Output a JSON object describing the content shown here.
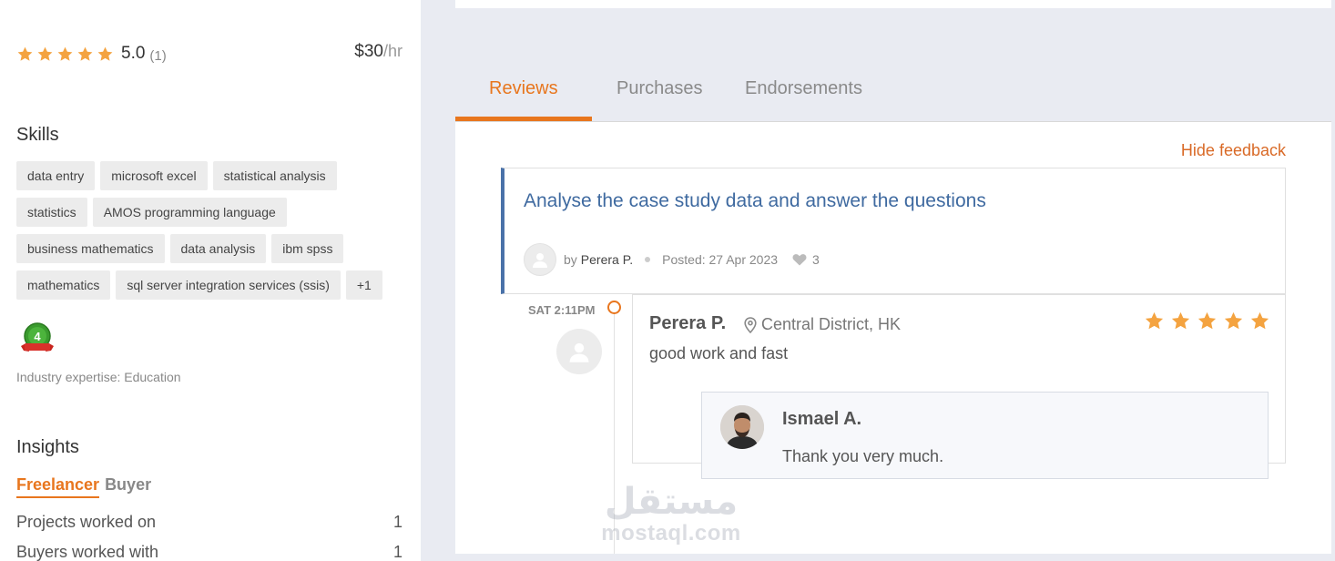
{
  "sidebar": {
    "rating": {
      "value": "5.0",
      "count": "(1)",
      "stars": 5
    },
    "rate": {
      "amount": "$30",
      "unit": "/hr"
    },
    "skills_title": "Skills",
    "skills": [
      "data entry",
      "microsoft excel",
      "statistical analysis",
      "statistics",
      "AMOS programming language",
      "business mathematics",
      "data analysis",
      "ibm spss",
      "mathematics",
      "sql server integration services (ssis)",
      "+1"
    ],
    "badge": {
      "number": "4",
      "icon": "award-badge-icon"
    },
    "industry": "Industry expertise: Education",
    "insights_title": "Insights",
    "insight_tabs": {
      "active": "Freelancer",
      "inactive": "Buyer"
    },
    "insight_rows": [
      {
        "label": "Projects worked on",
        "value": "1"
      },
      {
        "label": "Buyers worked with",
        "value": "1"
      }
    ]
  },
  "tabs": [
    {
      "label": "Reviews",
      "active": true
    },
    {
      "label": "Purchases",
      "active": false
    },
    {
      "label": "Endorsements",
      "active": false
    }
  ],
  "feedback": {
    "hide_label": "Hide feedback",
    "project_title": "Analyse the case study data and answer the questions",
    "by_prefix": "by",
    "author": "Perera P.",
    "posted": "Posted: 27 Apr 2023",
    "likes": "3",
    "time": "SAT 2:11PM",
    "review": {
      "reviewer": "Perera P.",
      "location": "Central District, HK",
      "text": "good work and fast",
      "stars": 5
    },
    "reply": {
      "name": "Ismael A.",
      "text": "Thank you very much."
    }
  },
  "watermark": {
    "arabic": "مستقل",
    "latin": "mostaql.com"
  },
  "colors": {
    "accent": "#e8761e",
    "link": "#3f6aa0",
    "star": "#f4a340",
    "border_accent": "#4a72a9"
  }
}
